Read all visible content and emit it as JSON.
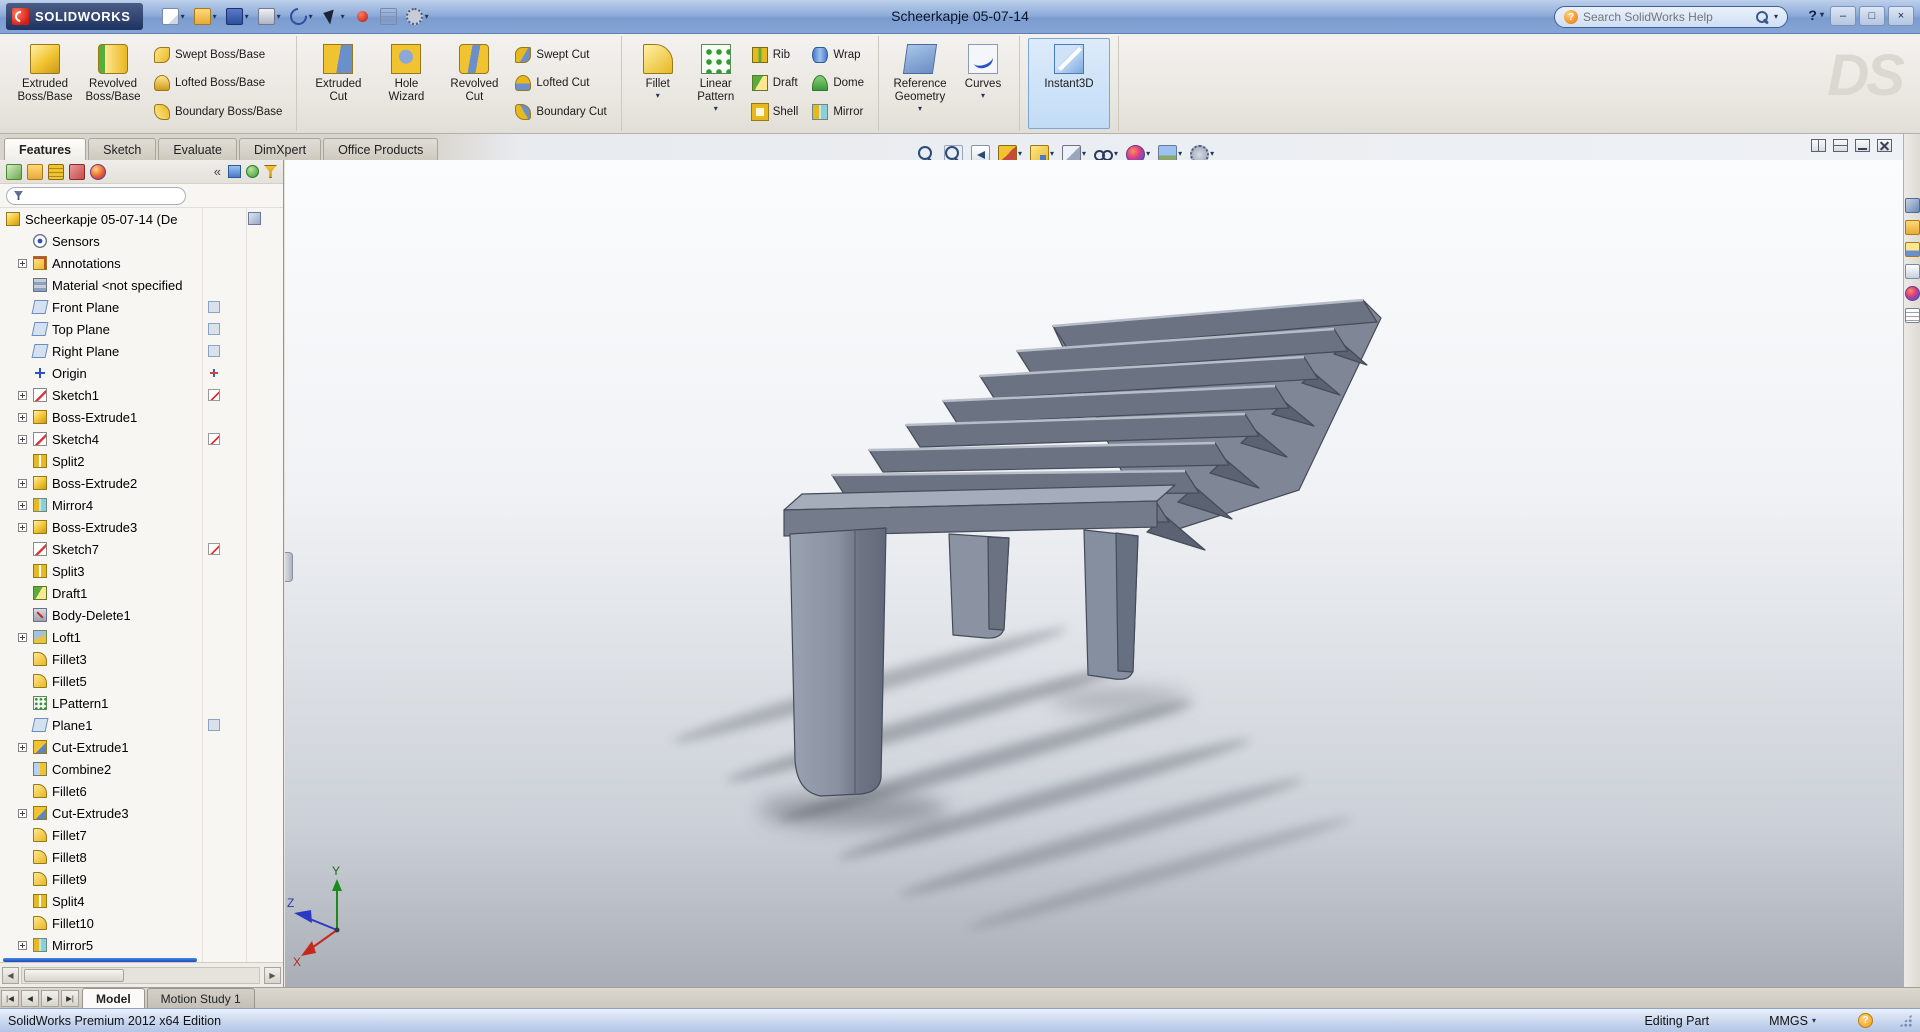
{
  "glyphs": {
    "caret": "▾",
    "collapse": "«",
    "help": "?"
  },
  "titlebar": {
    "app_name": "SOLIDWORKS",
    "title": "Scheerkapje 05-07-14",
    "search_placeholder": "Search SolidWorks Help",
    "quick_access": [
      {
        "name": "new-document",
        "ic": "qa-new",
        "caret": true
      },
      {
        "name": "open-document",
        "ic": "qa-open",
        "caret": true
      },
      {
        "name": "save-document",
        "ic": "qa-save",
        "caret": true
      },
      {
        "name": "print-document",
        "ic": "qa-print",
        "caret": true
      },
      {
        "name": "undo",
        "ic": "qa-undo",
        "caret": true
      },
      {
        "name": "select",
        "ic": "qa-select",
        "caret": true
      },
      {
        "name": "record-macro",
        "ic": "qa-record",
        "caret": false
      },
      {
        "name": "file-properties",
        "ic": "qa-props",
        "caret": false
      },
      {
        "name": "options",
        "ic": "qa-options",
        "caret": true
      }
    ],
    "window_buttons": [
      {
        "name": "minimize",
        "glyph": "–"
      },
      {
        "name": "maximize",
        "glyph": "□"
      },
      {
        "name": "close",
        "glyph": "×"
      }
    ]
  },
  "ribbon": {
    "watermark": "DS",
    "groups": [
      {
        "large": [
          {
            "label": [
              "Extruded",
              "Boss/Base"
            ],
            "ic": "rb-extrude"
          },
          {
            "label": [
              "Revolved",
              "Boss/Base"
            ],
            "ic": "rb-revolve"
          }
        ],
        "small": [
          [
            {
              "label": "Swept Boss/Base",
              "ic": "i-swept"
            },
            {
              "label": "Lofted Boss/Base",
              "ic": "i-loft"
            },
            {
              "label": "Boundary Boss/Base",
              "ic": "i-boundary"
            }
          ]
        ]
      },
      {
        "large": [
          {
            "label": [
              "Extruded",
              "Cut"
            ],
            "ic": "rb-extrudecut"
          },
          {
            "label": [
              "Hole",
              "Wizard"
            ],
            "ic": "rb-holewizard"
          },
          {
            "label": [
              "Revolved",
              "Cut"
            ],
            "ic": "rb-revolvecut"
          }
        ],
        "small": [
          [
            {
              "label": "Swept Cut",
              "ic": "i-sweptcut"
            },
            {
              "label": "Lofted Cut",
              "ic": "i-loftcut"
            },
            {
              "label": "Boundary Cut",
              "ic": "i-boundarycut"
            }
          ]
        ]
      },
      {
        "large": [
          {
            "label": [
              "Fillet"
            ],
            "ic": "rb-fillet",
            "caret": true,
            "narrow": true
          },
          {
            "label": [
              "Linear",
              "Pattern"
            ],
            "ic": "rb-linpattern",
            "caret": true,
            "narrow": true
          }
        ],
        "small": [
          [
            {
              "label": "Rib",
              "ic": "i-rib"
            },
            {
              "label": "Draft",
              "ic": "i-draft"
            },
            {
              "label": "Shell",
              "ic": "i-shell"
            }
          ],
          [
            {
              "label": "Wrap",
              "ic": "i-wrap"
            },
            {
              "label": "Dome",
              "ic": "i-dome"
            },
            {
              "label": "Mirror",
              "ic": "i-mirror"
            }
          ]
        ]
      },
      {
        "large": [
          {
            "label": [
              "Reference",
              "Geometry"
            ],
            "ic": "rb-refgeom",
            "caret": true
          },
          {
            "label": [
              "Curves"
            ],
            "ic": "rb-curves",
            "caret": true,
            "narrow": true
          }
        ],
        "small": []
      },
      {
        "large": [
          {
            "label": [
              "Instant3D"
            ],
            "ic": "rb-instant3d",
            "active": true,
            "wide": true
          }
        ],
        "small": []
      }
    ]
  },
  "command_tabs": {
    "items": [
      "Features",
      "Sketch",
      "Evaluate",
      "DimXpert",
      "Office Products"
    ],
    "active": 0,
    "pane_buttons": [
      {
        "name": "split-pane",
        "ic": "pb-a"
      },
      {
        "name": "tile-pane",
        "ic": "pb-b"
      },
      {
        "name": "minimize-frame",
        "ic": "pb-min"
      },
      {
        "name": "close-frame",
        "ic": "pb-close"
      }
    ]
  },
  "headsup": {
    "items": [
      {
        "name": "zoom-to-fit",
        "ic": "hu-mag",
        "caret": false
      },
      {
        "name": "zoom-to-area",
        "ic": "hu-magarea",
        "caret": false
      },
      {
        "name": "previous-view",
        "ic": "hu-prev",
        "caret": false
      },
      {
        "name": "section-view",
        "ic": "hu-section",
        "caret": true
      },
      {
        "name": "view-orientation",
        "ic": "hu-orient",
        "caret": true
      },
      {
        "name": "display-style",
        "ic": "hu-display",
        "caret": true
      },
      {
        "name": "hide-show-items",
        "ic": "hu-glasses",
        "caret": true
      },
      {
        "name": "edit-appearance",
        "ic": "hu-ball",
        "caret": true
      },
      {
        "name": "apply-scene",
        "ic": "hu-scene",
        "caret": true
      },
      {
        "name": "view-settings",
        "ic": "hu-vset",
        "caret": true
      }
    ]
  },
  "feature_tree": {
    "toolbar_left": [
      {
        "name": "featuremanager-design-tree",
        "ic": "pt-tree"
      },
      {
        "name": "propertymanager",
        "ic": "pt-prop"
      },
      {
        "name": "configurationmanager",
        "ic": "pt-config"
      },
      {
        "name": "dimxpertmanager",
        "ic": "pt-dimx"
      },
      {
        "name": "displaymanager",
        "ic": "pt-disp"
      }
    ],
    "toolbar_right": [
      {
        "name": "display-pane-toggle",
        "ic": "pt-a"
      },
      {
        "name": "show-hierarchy",
        "ic": "pt-b"
      },
      {
        "name": "tree-filter",
        "ic": "pt-c"
      }
    ],
    "filter_placeholder": "",
    "root": {
      "label": "Scheerkapje 05-07-14  (De",
      "ic": "t-part"
    },
    "items": [
      {
        "label": "Sensors",
        "ic": "t-sensors"
      },
      {
        "label": "Annotations",
        "ic": "t-annot",
        "plus": true
      },
      {
        "label": "Material <not specified",
        "ic": "t-material"
      },
      {
        "label": "Front Plane",
        "ic": "t-plane",
        "side": "plane"
      },
      {
        "label": "Top Plane",
        "ic": "t-plane",
        "side": "plane"
      },
      {
        "label": "Right Plane",
        "ic": "t-plane",
        "side": "plane"
      },
      {
        "label": "Origin",
        "ic": "t-origin",
        "side": "origin"
      },
      {
        "label": "Sketch1",
        "ic": "t-sketch",
        "plus": true,
        "side": "sketch"
      },
      {
        "label": "Boss-Extrude1",
        "ic": "t-extrude",
        "plus": true
      },
      {
        "label": "Sketch4",
        "ic": "t-sketch",
        "plus": true,
        "side": "sketch"
      },
      {
        "label": "Split2",
        "ic": "t-split"
      },
      {
        "label": "Boss-Extrude2",
        "ic": "t-extrude",
        "plus": true
      },
      {
        "label": "Mirror4",
        "ic": "t-mirror",
        "plus": true
      },
      {
        "label": "Boss-Extrude3",
        "ic": "t-extrude",
        "plus": true
      },
      {
        "label": "Sketch7",
        "ic": "t-sketch",
        "side": "sketch"
      },
      {
        "label": "Split3",
        "ic": "t-split"
      },
      {
        "label": "Draft1",
        "ic": "t-draft"
      },
      {
        "label": "Body-Delete1",
        "ic": "t-bodydel"
      },
      {
        "label": "Loft1",
        "ic": "t-loft",
        "plus": true
      },
      {
        "label": "Fillet3",
        "ic": "t-fillet"
      },
      {
        "label": "Fillet5",
        "ic": "t-fillet"
      },
      {
        "label": "LPattern1",
        "ic": "t-lpattern"
      },
      {
        "label": "Plane1",
        "ic": "t-plane",
        "side": "plane"
      },
      {
        "label": "Cut-Extrude1",
        "ic": "t-cutextrude",
        "plus": true
      },
      {
        "label": "Combine2",
        "ic": "t-combine"
      },
      {
        "label": "Fillet6",
        "ic": "t-fillet"
      },
      {
        "label": "Cut-Extrude3",
        "ic": "t-cutextrude",
        "plus": true
      },
      {
        "label": "Fillet7",
        "ic": "t-fillet"
      },
      {
        "label": "Fillet8",
        "ic": "t-fillet"
      },
      {
        "label": "Fillet9",
        "ic": "t-fillet"
      },
      {
        "label": "Split4",
        "ic": "t-split"
      },
      {
        "label": "Fillet10",
        "ic": "t-fillet"
      },
      {
        "label": "Mirror5",
        "ic": "t-mirror",
        "plus": true
      }
    ]
  },
  "task_pane": {
    "items": [
      {
        "name": "solidworks-resources",
        "ic": "ts-res"
      },
      {
        "name": "design-library",
        "ic": "ts-lib"
      },
      {
        "name": "file-explorer",
        "ic": "ts-exp"
      },
      {
        "name": "view-palette",
        "ic": "ts-pal"
      },
      {
        "name": "appearances-scenes",
        "ic": "ts-app"
      },
      {
        "name": "custom-properties",
        "ic": "ts-props"
      }
    ]
  },
  "viewport": {
    "triad": {
      "x": "X",
      "y": "Y",
      "z": "Z"
    }
  },
  "bottom_bar": {
    "nav": [
      "|◀",
      "◀",
      "▶",
      "▶|"
    ],
    "tabs": [
      "Model",
      "Motion Study 1"
    ],
    "active": 0
  },
  "status_bar": {
    "left": "SolidWorks Premium 2012 x64 Edition",
    "mode": "Editing Part",
    "units": "MMGS"
  }
}
